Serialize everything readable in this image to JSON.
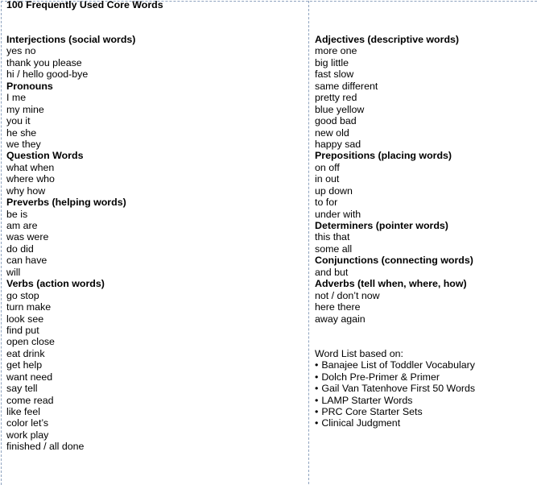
{
  "title": "100 Frequently Used Core Words",
  "left_column": [
    {
      "heading": "Interjections (social words)",
      "items": [
        "yes no",
        "thank you please",
        "hi / hello good-bye"
      ]
    },
    {
      "heading": "Pronouns",
      "items": [
        "I me",
        "my mine",
        "you it",
        "he she",
        "we they"
      ]
    },
    {
      "heading": "Question Words",
      "items": [
        "what when",
        "where who",
        "why how"
      ]
    },
    {
      "heading": "Preverbs (helping words)",
      "items": [
        "be is",
        "am are",
        "was were",
        "do did",
        "can have",
        "will"
      ]
    },
    {
      "heading": "Verbs (action words)",
      "items": [
        "go stop",
        "turn make",
        "look see",
        "find put",
        "open close",
        "eat drink",
        "get help",
        "want need",
        "say tell",
        "come read",
        "like feel",
        "color let’s",
        "work play",
        "finished / all done"
      ]
    }
  ],
  "right_column": [
    {
      "heading": "Adjectives (descriptive words)",
      "items": [
        "more one",
        "big little",
        "fast slow",
        "same different",
        "pretty red",
        "blue yellow",
        "good bad",
        "new old",
        "happy sad"
      ]
    },
    {
      "heading": "Prepositions (placing words)",
      "items": [
        "on off",
        "in out",
        "up down",
        "to for",
        "under with"
      ]
    },
    {
      "heading": "Determiners (pointer words)",
      "items": [
        "this that",
        "some all"
      ]
    },
    {
      "heading": "Conjunctions (connecting words)",
      "items": [
        "and but"
      ]
    },
    {
      "heading": "Adverbs (tell when, where, how)",
      "items": [
        "not / don’t now",
        "here there",
        "away again"
      ]
    }
  ],
  "sources": {
    "label": "Word List based on:",
    "bullet": "•",
    "items": [
      "Banajee List of Toddler Vocabulary",
      "Dolch Pre-Primer & Primer",
      "Gail Van Tatenhove First 50 Words",
      "LAMP Starter Words",
      "PRC Core Starter Sets",
      "Clinical Judgment"
    ]
  },
  "colors": {
    "gridline": "#8fa3bf",
    "text": "#000000",
    "background": "#ffffff"
  }
}
